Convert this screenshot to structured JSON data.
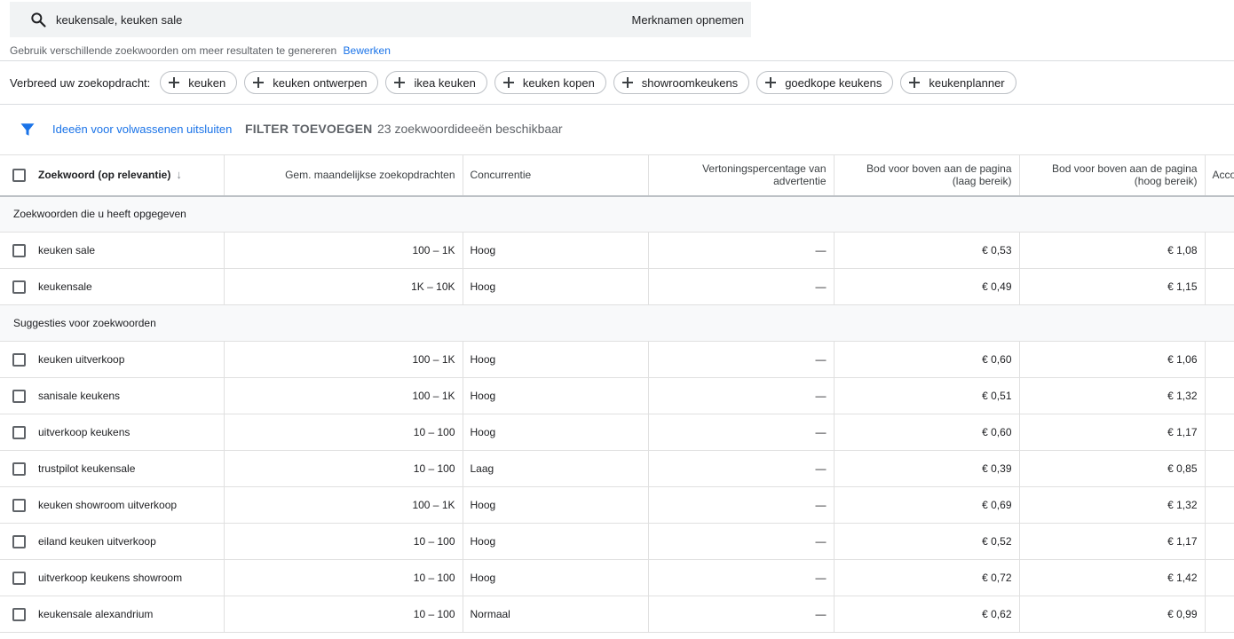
{
  "search": {
    "query": "keukensale, keuken sale",
    "brand_button": "Merknamen opnemen",
    "hint": "Gebruik verschillende zoekwoorden om meer resultaten te genereren",
    "edit_link": "Bewerken"
  },
  "broaden": {
    "label": "Verbreed uw zoekopdracht:",
    "chips": [
      "keuken",
      "keuken ontwerpen",
      "ikea keuken",
      "keuken kopen",
      "showroomkeukens",
      "goedkope keukens",
      "keukenplanner"
    ]
  },
  "filter": {
    "adult_toggle": "Ideeën voor volwassenen uitsluiten",
    "add_filter": "FILTER TOEVOEGEN",
    "available": "23 zoekwoordideeën beschikbaar"
  },
  "table": {
    "headers": {
      "keyword": "Zoekwoord (op relevantie)",
      "monthly": "Gem. maandelijkse zoekopdrachten",
      "competition": "Concurrentie",
      "impression_share": "Vertoningspercentage van advertentie",
      "bid_low": "Bod voor boven aan de pagina (laag bereik)",
      "bid_high": "Bod voor boven aan de pagina (hoog bereik)",
      "account": "Acco"
    },
    "section_provided": "Zoekwoorden die u heeft opgegeven",
    "section_suggestions": "Suggesties voor zoekwoorden",
    "provided_rows": [
      {
        "keyword": "keuken sale",
        "monthly": "100 – 1K",
        "competition": "Hoog",
        "share": "—",
        "low": "€ 0,53",
        "high": "€ 1,08"
      },
      {
        "keyword": "keukensale",
        "monthly": "1K – 10K",
        "competition": "Hoog",
        "share": "—",
        "low": "€ 0,49",
        "high": "€ 1,15"
      }
    ],
    "suggestion_rows": [
      {
        "keyword": "keuken uitverkoop",
        "monthly": "100 – 1K",
        "competition": "Hoog",
        "share": "—",
        "low": "€ 0,60",
        "high": "€ 1,06"
      },
      {
        "keyword": "sanisale keukens",
        "monthly": "100 – 1K",
        "competition": "Hoog",
        "share": "—",
        "low": "€ 0,51",
        "high": "€ 1,32"
      },
      {
        "keyword": "uitverkoop keukens",
        "monthly": "10 – 100",
        "competition": "Hoog",
        "share": "—",
        "low": "€ 0,60",
        "high": "€ 1,17"
      },
      {
        "keyword": "trustpilot keukensale",
        "monthly": "10 – 100",
        "competition": "Laag",
        "share": "—",
        "low": "€ 0,39",
        "high": "€ 0,85"
      },
      {
        "keyword": "keuken showroom uitverkoop",
        "monthly": "100 – 1K",
        "competition": "Hoog",
        "share": "—",
        "low": "€ 0,69",
        "high": "€ 1,32"
      },
      {
        "keyword": "eiland keuken uitverkoop",
        "monthly": "10 – 100",
        "competition": "Hoog",
        "share": "—",
        "low": "€ 0,52",
        "high": "€ 1,17"
      },
      {
        "keyword": "uitverkoop keukens showroom",
        "monthly": "10 – 100",
        "competition": "Hoog",
        "share": "—",
        "low": "€ 0,72",
        "high": "€ 1,42"
      },
      {
        "keyword": "keukensale alexandrium",
        "monthly": "10 – 100",
        "competition": "Normaal",
        "share": "—",
        "low": "€ 0,62",
        "high": "€ 0,99"
      }
    ]
  },
  "icons": {
    "search": "search-icon",
    "filter": "filter-icon",
    "plus": "plus-icon",
    "sort": "arrow-down-icon"
  },
  "colors": {
    "accent": "#1a73e8",
    "filter_icon": "#1a73e8",
    "search_bg": "#f1f3f4"
  }
}
